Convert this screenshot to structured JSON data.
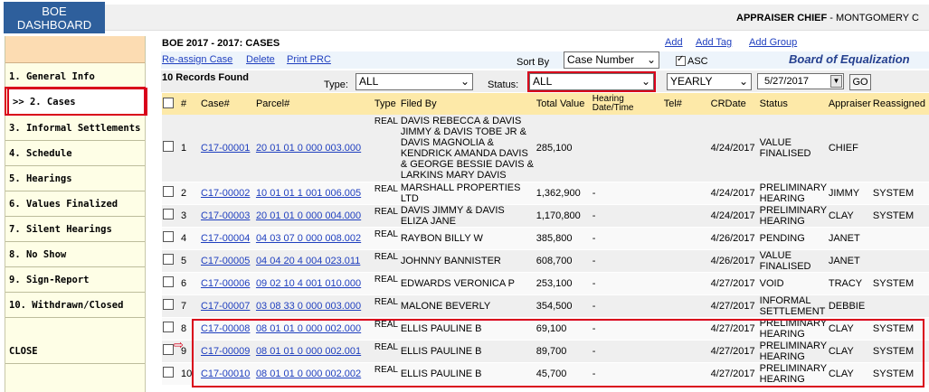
{
  "nav": {
    "dashboard_label": "BOE DASHBOARD",
    "user_role": "APPRAISER CHIEF",
    "user_county": " - MONTGOMERY C",
    "menu": [
      {
        "label": "1. General Info"
      },
      {
        "label": ">> 2. Cases"
      },
      {
        "label": "3. Informal Settlements"
      },
      {
        "label": "4. Schedule"
      },
      {
        "label": "5. Hearings"
      },
      {
        "label": "6. Values Finalized"
      },
      {
        "label": "7. Silent Hearings"
      },
      {
        "label": "8. No Show"
      },
      {
        "label": "9. Sign-Report"
      },
      {
        "label": "10. Withdrawn/Closed"
      }
    ],
    "close_label": "CLOSE"
  },
  "page": {
    "title": "BOE 2017 - 2017: CASES",
    "top_links": {
      "add": "Add",
      "add_tag": "Add Tag",
      "add_group": "Add Group"
    },
    "actions": {
      "reassign": "Re-assign Case",
      "delete": "Delete",
      "print": "Print PRC"
    },
    "sort_by_label": "Sort By",
    "sort_by_value": "Case Number",
    "asc_label": "ASC",
    "asc_checked": true,
    "brand": "Board of Equalization",
    "records_found": "10 Records Found",
    "type_label": "Type:",
    "type_value": "ALL",
    "status_label": "Status:",
    "status_value": "ALL",
    "period_value": "YEARLY",
    "date_value": "5/27/2017",
    "go_label": "GO"
  },
  "table": {
    "headers": {
      "num": "#",
      "case": "Case#",
      "parcel": "Parcel#",
      "type": "Type",
      "filed_by": "Filed By",
      "total_value": "Total Value",
      "hearing": "Hearing Date/Time",
      "tel": "Tel#",
      "crdate": "CRDate",
      "status": "Status",
      "appraiser": "Appraiser",
      "reassigned": "Reassigned"
    },
    "rows": [
      {
        "num": "1",
        "case": "C17-00001",
        "parcel": "20 01 01 0 000 003.000",
        "type": "REAL",
        "filed_by": "DAVIS REBECCA & DAVIS JIMMY & DAVIS TOBE JR & DAVIS MAGNOLIA & KENDRICK AMANDA DAVIS & GEORGE BESSIE DAVIS & LARKINS MARY DAVIS",
        "total_value": "285,100",
        "hearing": "",
        "tel": "",
        "crdate": "4/24/2017",
        "status": "VALUE FINALISED",
        "appraiser": "CHIEF",
        "reassigned": ""
      },
      {
        "num": "2",
        "case": "C17-00002",
        "parcel": "10 01 01 1 001 006.005",
        "type": "REAL",
        "filed_by": "MARSHALL PROPERTIES LTD",
        "total_value": "1,362,900",
        "hearing": "-",
        "tel": "",
        "crdate": "4/24/2017",
        "status": "PRELIMINARY HEARING",
        "appraiser": "JIMMY",
        "reassigned": "SYSTEM"
      },
      {
        "num": "3",
        "case": "C17-00003",
        "parcel": "20 01 01 0 000 004.000",
        "type": "REAL",
        "filed_by": "DAVIS JIMMY & DAVIS ELIZA JANE",
        "total_value": "1,170,800",
        "hearing": "-",
        "tel": "",
        "crdate": "4/24/2017",
        "status": "PRELIMINARY HEARING",
        "appraiser": "CLAY",
        "reassigned": "SYSTEM"
      },
      {
        "num": "4",
        "case": "C17-00004",
        "parcel": "04 03 07 0 000 008.002",
        "type": "REAL",
        "filed_by": "RAYBON BILLY W",
        "total_value": "385,800",
        "hearing": "-",
        "tel": "",
        "crdate": "4/26/2017",
        "status": "PENDING",
        "appraiser": "JANET",
        "reassigned": ""
      },
      {
        "num": "5",
        "case": "C17-00005",
        "parcel": "04 04 20 4 004 023.011",
        "type": "REAL",
        "filed_by": "JOHNNY BANNISTER",
        "total_value": "608,700",
        "hearing": "-",
        "tel": "",
        "crdate": "4/26/2017",
        "status": "VALUE FINALISED",
        "appraiser": "JANET",
        "reassigned": ""
      },
      {
        "num": "6",
        "case": "C17-00006",
        "parcel": "09 02 10 4 001 010.000",
        "type": "REAL",
        "filed_by": "EDWARDS VERONICA P",
        "total_value": "253,100",
        "hearing": "-",
        "tel": "",
        "crdate": "4/27/2017",
        "status": "VOID",
        "appraiser": "TRACY",
        "reassigned": "SYSTEM"
      },
      {
        "num": "7",
        "case": "C17-00007",
        "parcel": "03 08 33 0 000 003.000",
        "type": "REAL",
        "filed_by": "MALONE BEVERLY",
        "total_value": "354,500",
        "hearing": "-",
        "tel": "",
        "crdate": "4/27/2017",
        "status": "INFORMAL SETTLEMENT",
        "appraiser": "DEBBIE",
        "reassigned": ""
      },
      {
        "num": "8",
        "case": "C17-00008",
        "parcel": "08 01 01 0 000 002.000",
        "type": "REAL",
        "filed_by": "ELLIS PAULINE B",
        "total_value": "69,100",
        "hearing": "-",
        "tel": "",
        "crdate": "4/27/2017",
        "status": "PRELIMINARY HEARING",
        "appraiser": "CLAY",
        "reassigned": "SYSTEM"
      },
      {
        "num": "9",
        "case": "C17-00009",
        "parcel": "08 01 01 0 000 002.001",
        "type": "REAL",
        "filed_by": "ELLIS PAULINE B",
        "total_value": "89,700",
        "hearing": "-",
        "tel": "",
        "crdate": "4/27/2017",
        "status": "PRELIMINARY HEARING",
        "appraiser": "CLAY",
        "reassigned": "SYSTEM"
      },
      {
        "num": "10",
        "case": "C17-00010",
        "parcel": "08 01 01 0 000 002.002",
        "type": "REAL",
        "filed_by": "ELLIS PAULINE B",
        "total_value": "45,700",
        "hearing": "-",
        "tel": "",
        "crdate": "4/27/2017",
        "status": "PRELIMINARY HEARING",
        "appraiser": "CLAY",
        "reassigned": "SYSTEM"
      }
    ]
  },
  "colors": {
    "highlight": "#d9001b",
    "link": "#1f3fbf",
    "header_row": "#fde9a8",
    "nav_button": "#2e5f9c"
  },
  "icons": {
    "pointer": "right-arrow-icon",
    "calendar": "calendar-dropdown-icon"
  }
}
